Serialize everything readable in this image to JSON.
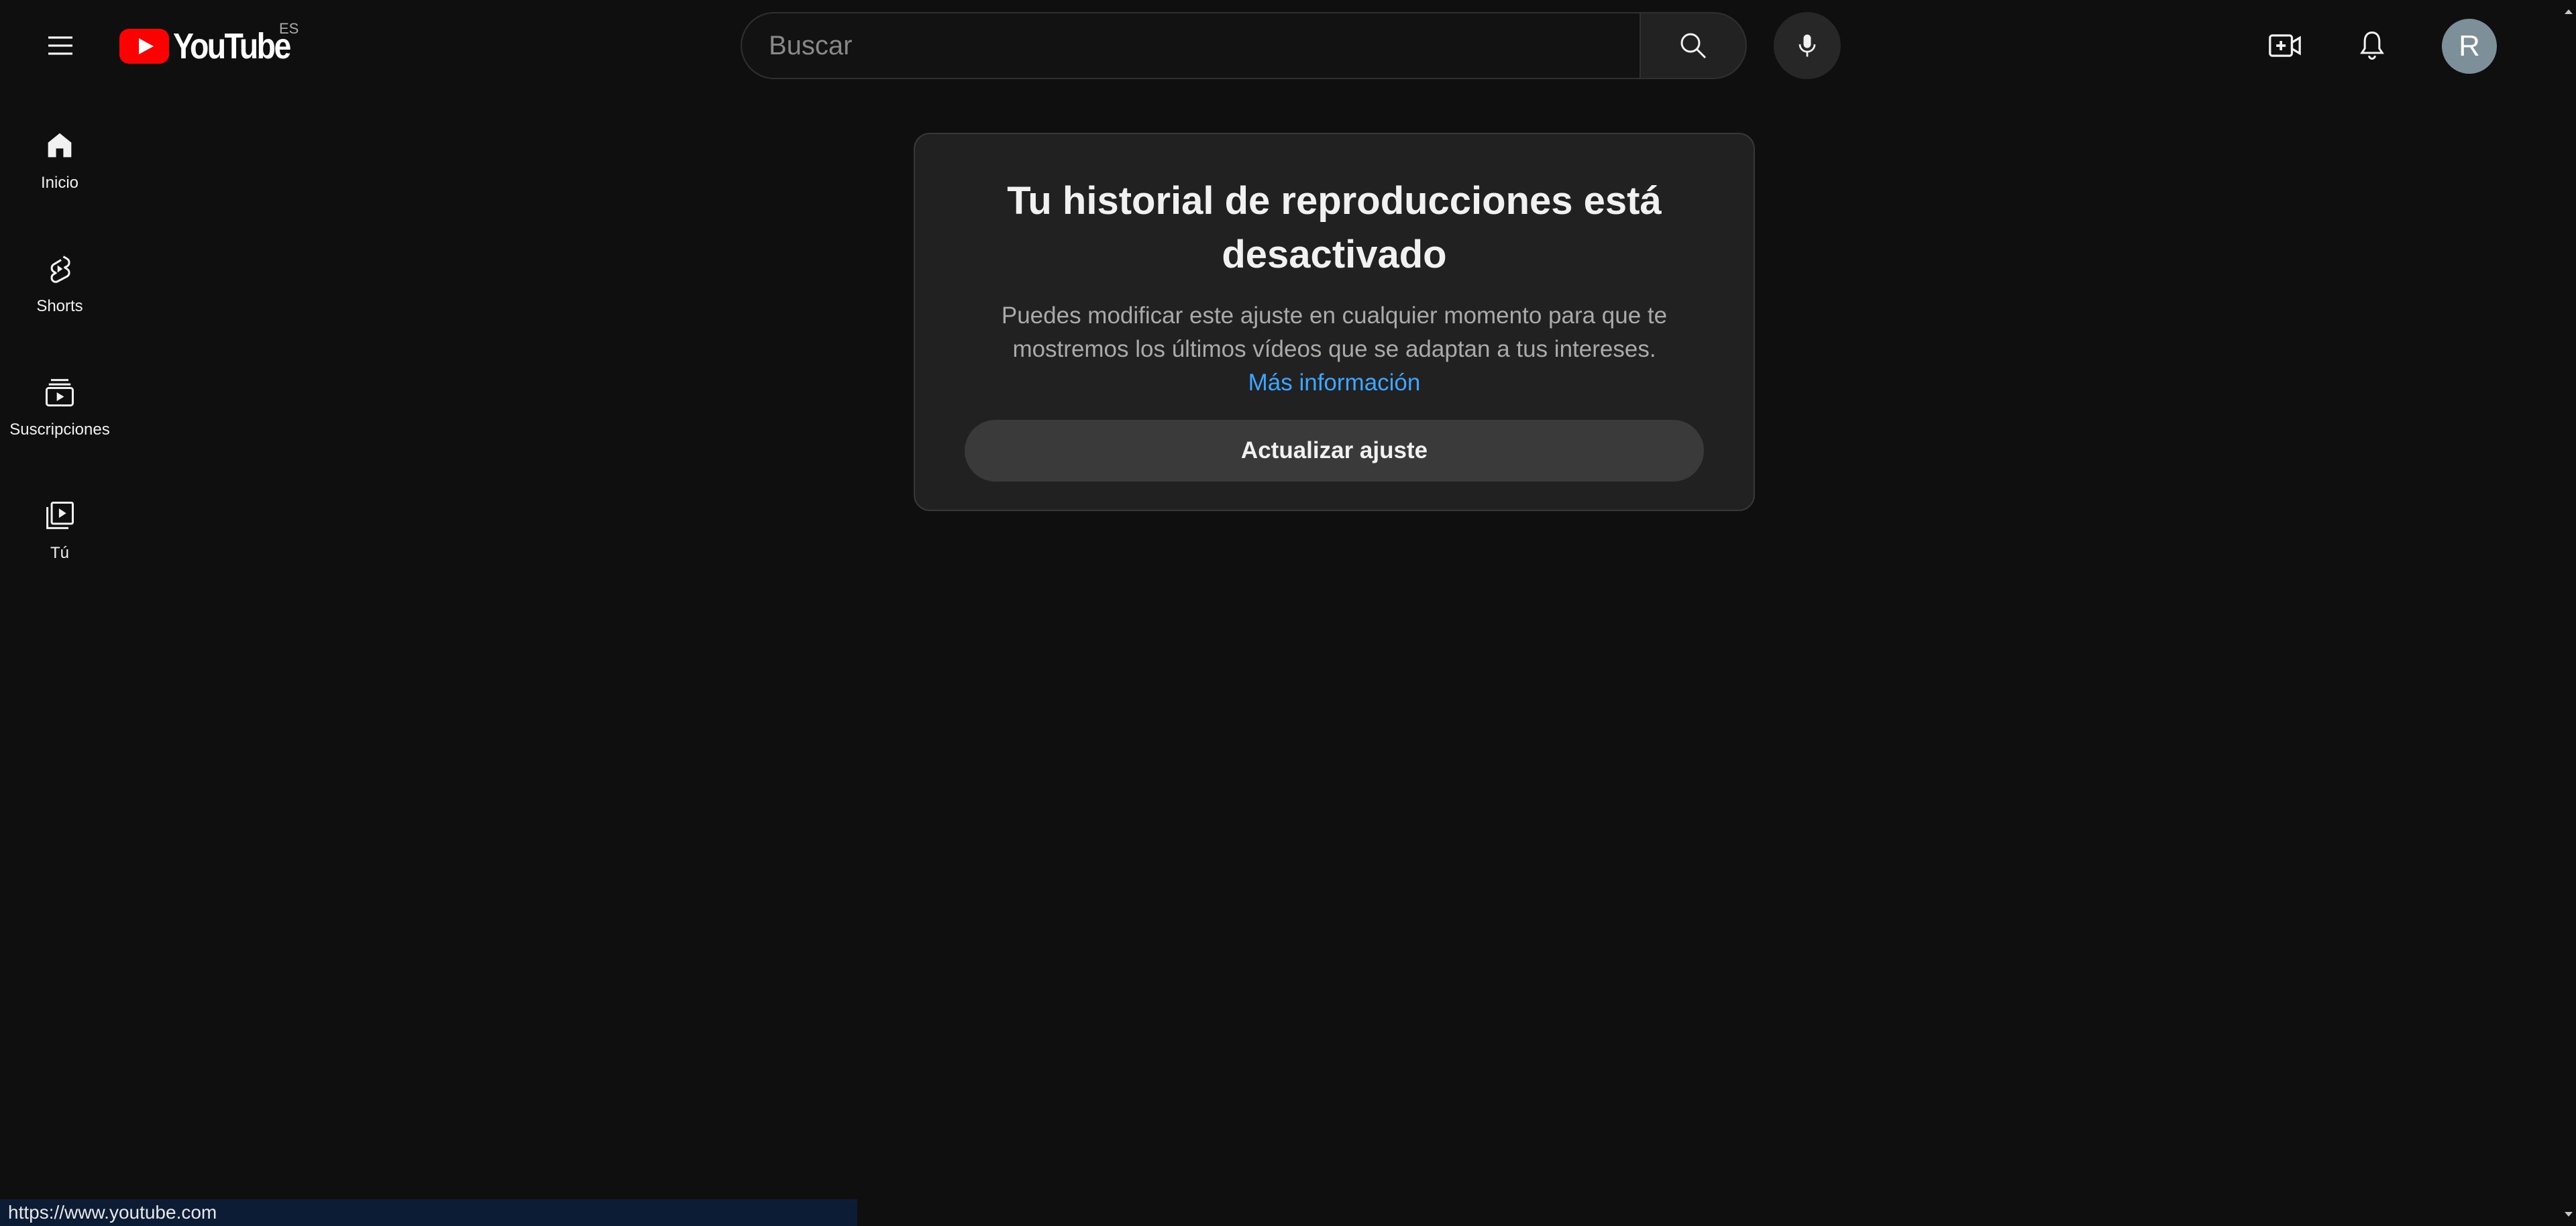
{
  "header": {
    "logo_text": "YouTube",
    "logo_country": "ES",
    "search_placeholder": "Buscar",
    "avatar_initial": "R",
    "icons": [
      "menu-icon",
      "youtube-logo-icon",
      "search-icon",
      "mic-icon",
      "create-icon",
      "bell-icon"
    ]
  },
  "guide": {
    "items": [
      {
        "label": "Inicio",
        "icon": "home-icon"
      },
      {
        "label": "Shorts",
        "icon": "shorts-icon"
      },
      {
        "label": "Suscripciones",
        "icon": "subscriptions-icon"
      },
      {
        "label": "Tú",
        "icon": "you-icon"
      }
    ]
  },
  "card": {
    "title": "Tu historial de reproducciones está desactivado",
    "body": "Puedes modificar este ajuste en cualquier momento para que te mostremos los últimos vídeos que se adaptan a tus intereses.",
    "link": "Más información",
    "button": "Actualizar ajuste"
  },
  "status_bar": {
    "url": "https://www.youtube.com"
  },
  "colors": {
    "background": "#0f0f0f",
    "card": "#212121",
    "link": "#3ea6ff",
    "brand_red": "#ff0000",
    "avatar": "#7d8f99"
  }
}
